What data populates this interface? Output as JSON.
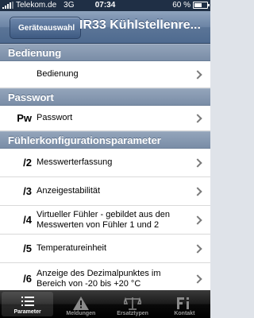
{
  "status_bar": {
    "carrier": "Telekom.de",
    "network": "3G",
    "time": "07:34",
    "battery": "60 %",
    "battery_level": 0.6
  },
  "nav": {
    "back_label": "Geräteauswahl",
    "title": "IR33 Kühlstellenre..."
  },
  "sections": {
    "bedienung": {
      "header": "Bedienung",
      "items": [
        {
          "code": "",
          "label": "Bedienung"
        }
      ]
    },
    "passwort": {
      "header": "Passwort",
      "items": [
        {
          "code": "Pw",
          "label": "Passwort"
        }
      ]
    },
    "fuehler": {
      "header": "Fühlerkonfigurationsparameter",
      "items": [
        {
          "code": "/2",
          "label": "Messwerterfassung"
        },
        {
          "code": "/3",
          "label": "Anzeigestabilität"
        },
        {
          "code": "/4",
          "label": "Virtueller Fühler - gebildet aus den Messwerten von Fühler 1 und 2"
        },
        {
          "code": "/5",
          "label": "Temperatureinheit"
        },
        {
          "code": "/6",
          "label": "Anzeige des Dezimalpunktes im Bereich von -20 bis +20 °C"
        }
      ]
    }
  },
  "tabs": [
    {
      "label": "Parameter",
      "icon": "list-icon",
      "active": true
    },
    {
      "label": "Meldungen",
      "icon": "warning-icon",
      "active": false
    },
    {
      "label": "Ersatztypen",
      "icon": "scale-icon",
      "active": false
    },
    {
      "label": "Kontakt",
      "icon": "fi-logo-icon",
      "active": false
    }
  ]
}
